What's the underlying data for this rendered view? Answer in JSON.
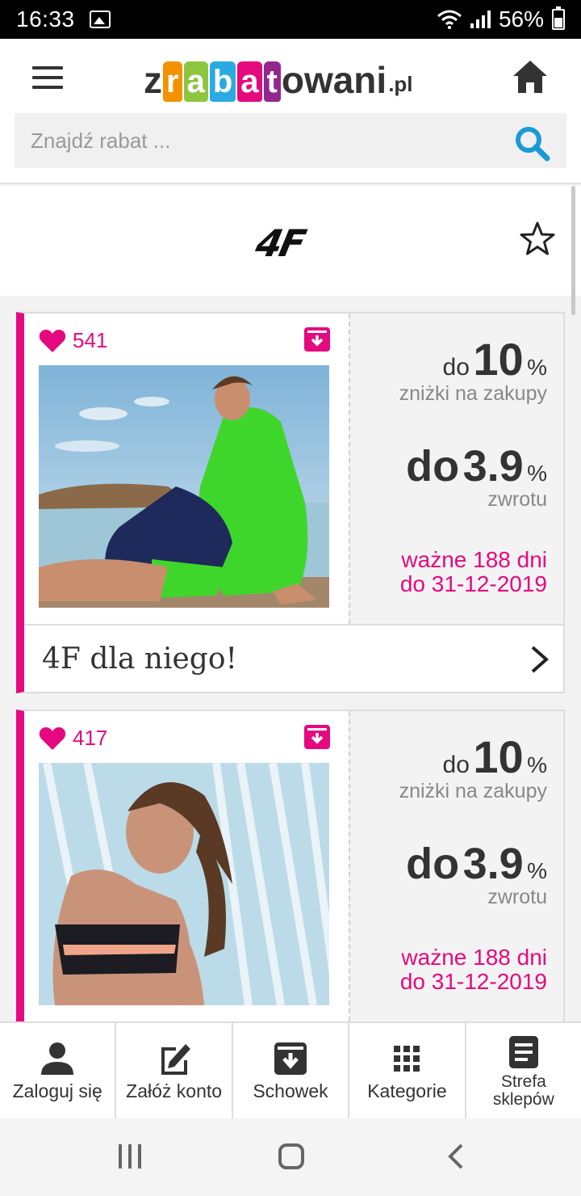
{
  "status_bar": {
    "time": "16:33",
    "battery": "56%"
  },
  "header": {
    "logo": {
      "z": "z",
      "r": "r",
      "a": "a",
      "b": "b",
      "a2": "a",
      "t": "t",
      "rest": "owani",
      "tld": ".pl"
    },
    "search_placeholder": "Znajdź rabat ..."
  },
  "brand": {
    "logo_text": "4F"
  },
  "colors": {
    "accent": "#e5097f",
    "search_icon": "#1a9ad6",
    "text": "#333333"
  },
  "cards": [
    {
      "likes": "541",
      "discount_prefix": "do",
      "discount_value": "10",
      "discount_unit": "%",
      "discount_label": "zniżki na zakupy",
      "cashback_prefix": "do",
      "cashback_value": "3.9",
      "cashback_unit": "%",
      "cashback_label": "zwrotu",
      "valid_days": "ważne 188 dni",
      "valid_until": "do 31-12-2019",
      "title": "4F dla niego!"
    },
    {
      "likes": "417",
      "discount_prefix": "do",
      "discount_value": "10",
      "discount_unit": "%",
      "discount_label": "zniżki na zakupy",
      "cashback_prefix": "do",
      "cashback_value": "3.9",
      "cashback_unit": "%",
      "cashback_label": "zwrotu",
      "valid_days": "ważne 188 dni",
      "valid_until": "do 31-12-2019"
    }
  ],
  "bottom_nav": {
    "login": "Zaloguj się",
    "register": "Załóż konto",
    "clipboard": "Schowek",
    "categories": "Kategorie",
    "shops_line1": "Strefa",
    "shops_line2": "sklepów"
  }
}
